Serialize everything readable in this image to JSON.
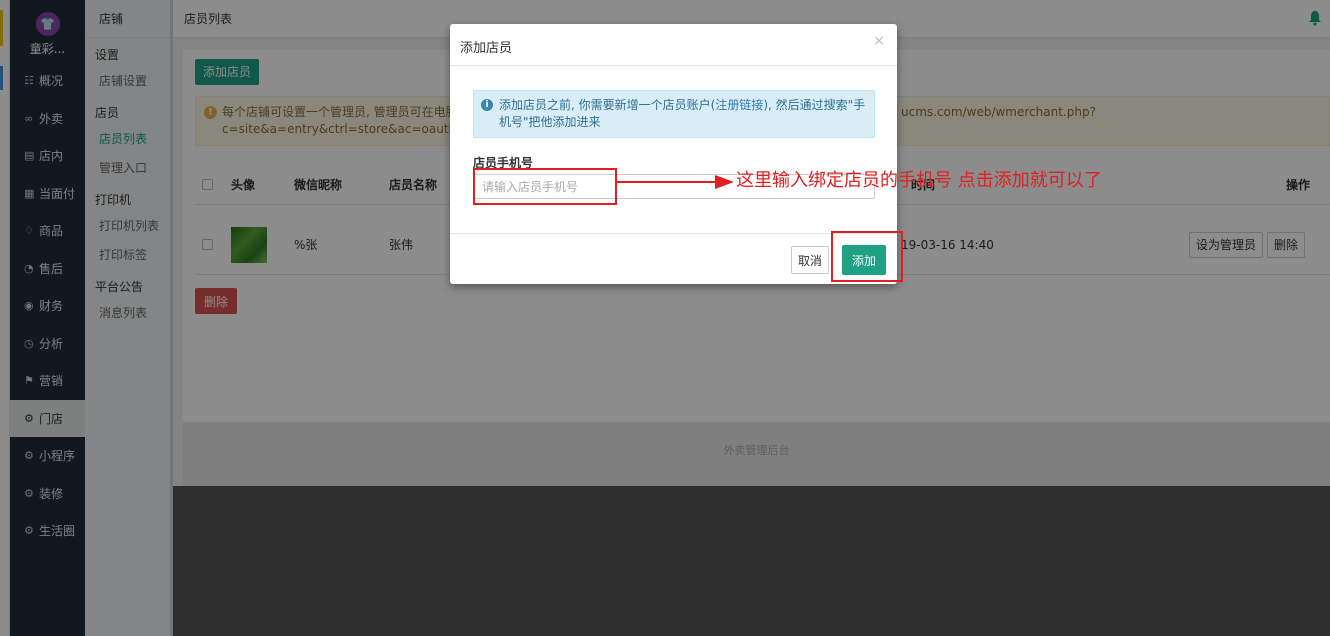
{
  "brand": {
    "logo_glyph": "👕",
    "name": "童彩..."
  },
  "nav": [
    {
      "icon": "☷",
      "label": "概况"
    },
    {
      "icon": "∞",
      "label": "外卖"
    },
    {
      "icon": "▤",
      "label": "店内"
    },
    {
      "icon": "▦",
      "label": "当面付"
    },
    {
      "icon": "♢",
      "label": "商品"
    },
    {
      "icon": "◔",
      "label": "售后"
    },
    {
      "icon": "◉",
      "label": "财务"
    },
    {
      "icon": "◷",
      "label": "分析"
    },
    {
      "icon": "⚑",
      "label": "营销"
    },
    {
      "icon": "⚙",
      "label": "门店"
    },
    {
      "icon": "⚙",
      "label": "小程序"
    },
    {
      "icon": "⚙",
      "label": "装修"
    },
    {
      "icon": "⚙",
      "label": "生活圈"
    }
  ],
  "subnav": {
    "title": "店铺",
    "groups": [
      {
        "label": "设置",
        "links": [
          "店铺设置"
        ]
      },
      {
        "label": "店员",
        "links": [
          "店员列表",
          "管理入口"
        ]
      },
      {
        "label": "打印机",
        "links": [
          "打印机列表",
          "打印标签"
        ]
      },
      {
        "label": "平台公告",
        "links": [
          "消息列表"
        ]
      }
    ]
  },
  "header": {
    "title": "店员列表"
  },
  "page": {
    "add_button": "添加店员",
    "notice_line1": "每个店铺可设置一个管理员, 管理员可在电脑",
    "notice_line2": "c=site&a=entry&ctrl=store&ac=oauth&op=",
    "notice_right": "ucms.com/web/wmerchant.php?",
    "columns": {
      "avatar": "头像",
      "nickname": "微信昵称",
      "name": "店员名称",
      "time": "时间",
      "ops": "操作"
    },
    "rows": [
      {
        "nickname": "%张",
        "name": "张伟",
        "time": "19-03-16 14:40",
        "btn_admin": "设为管理员",
        "btn_delete": "删除"
      }
    ],
    "delete_button": "删除",
    "footer": "外卖管理后台"
  },
  "modal": {
    "title": "添加店员",
    "close": "×",
    "info_prefix": "添加店员之前, 你需要新增一个店员账户(",
    "info_link": "注册链接",
    "info_suffix": "), 然后通过搜索\"手机号\"把他添加进来",
    "field_label": "店员手机号",
    "field_placeholder": "请输入店员手机号",
    "cancel": "取消",
    "confirm": "添加"
  },
  "annotation": {
    "text": "这里输入绑定店员的手机号  点击添加就可以了"
  }
}
